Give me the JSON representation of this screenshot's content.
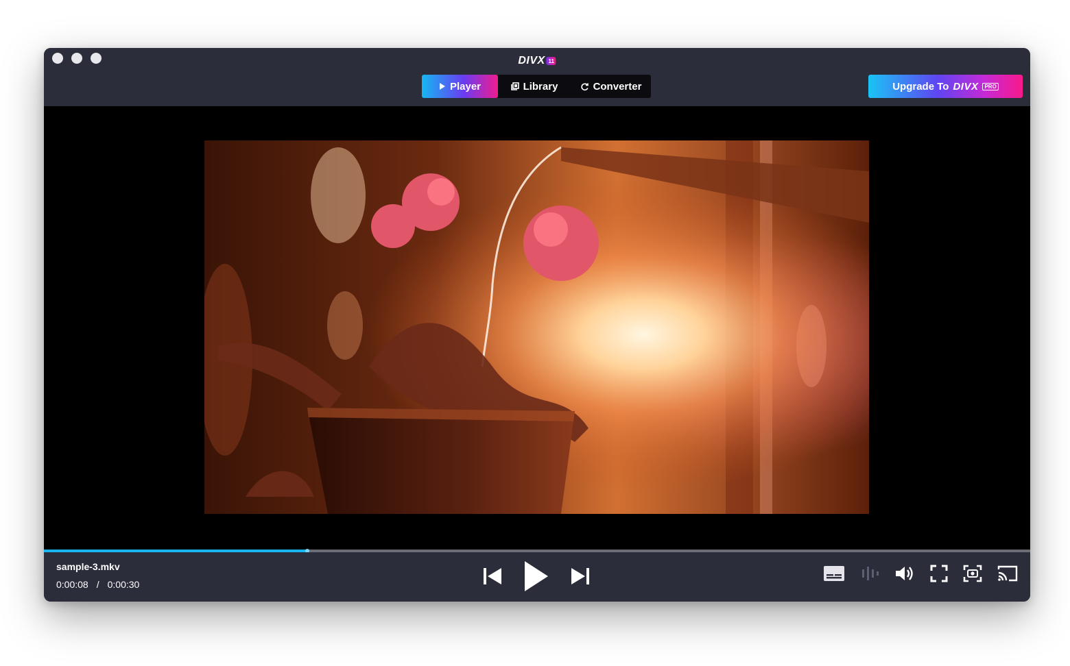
{
  "app": {
    "logo_text": "DIVX",
    "logo_badge": "11"
  },
  "nav": {
    "tabs": [
      {
        "label": "Player",
        "active": true
      },
      {
        "label": "Library",
        "active": false
      },
      {
        "label": "Converter",
        "active": false
      }
    ]
  },
  "upgrade": {
    "label": "Upgrade To",
    "brand": "DIVX",
    "badge": "PRO"
  },
  "player": {
    "filename": "sample-3.mkv",
    "current_time": "0:00:08",
    "separator": "/",
    "total_time": "0:00:30",
    "progress_fraction": 0.267
  },
  "icons": {
    "previous": "skip-previous-icon",
    "play": "play-icon",
    "next": "skip-next-icon",
    "subtitles": "subtitles-icon",
    "audio_track": "audio-track-icon",
    "volume": "volume-icon",
    "fullscreen": "fullscreen-icon",
    "snapshot": "camera-icon",
    "cast": "cast-icon"
  },
  "colors": {
    "window_bg": "#2b2d3b",
    "accent_blue": "#19b5ef",
    "accent_pink": "#f5187b",
    "accent_purple": "#6a3cf2"
  }
}
